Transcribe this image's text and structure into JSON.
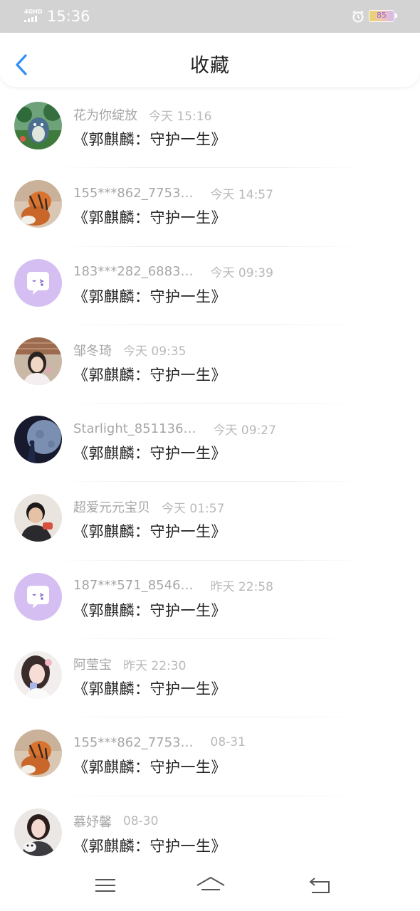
{
  "status_bar": {
    "network": "4GHD",
    "time": "15:36",
    "battery": "85"
  },
  "header": {
    "title": "收藏",
    "back_icon": "chevron-left-icon",
    "accent": "#2f8ff5"
  },
  "favorites": [
    {
      "user": "花为你绽放",
      "time": "今天 15:16",
      "content": "《郭麒麟：守护一生》",
      "avatar": "forest-totoro"
    },
    {
      "user": "155***862_7753…",
      "time": "今天 14:57",
      "content": "《郭麒麟：守护一生》",
      "avatar": "tiger-cat"
    },
    {
      "user": "183***282_6883…",
      "time": "今天 09:39",
      "content": "《郭麒麟：守护一生》",
      "avatar": "default-chat-bubble"
    },
    {
      "user": "邹冬琦",
      "time": "今天 09:35",
      "content": "《郭麒麟：守护一生》",
      "avatar": "girl-portrait"
    },
    {
      "user": "Starlight_851136…",
      "time": "今天 09:27",
      "content": "《郭麒麟：守护一生》",
      "avatar": "moon-night"
    },
    {
      "user": "超爱元元宝贝",
      "time": "今天 01:57",
      "content": "《郭麒麟：守护一生》",
      "avatar": "boy-portrait"
    },
    {
      "user": "187***571_8546…",
      "time": "昨天 22:58",
      "content": "《郭麒麟：守护一生》",
      "avatar": "default-chat-bubble"
    },
    {
      "user": "阿莹宝",
      "time": "昨天 22:30",
      "content": "《郭麒麟：守护一生》",
      "avatar": "anime-girl"
    },
    {
      "user": "155***862_7753…",
      "time": "08-31",
      "content": "《郭麒麟：守护一生》",
      "avatar": "tiger-cat"
    },
    {
      "user": "慕妤馨",
      "time": "08-30",
      "content": "《郭麒麟：守护一生》",
      "avatar": "girl-with-cat"
    }
  ],
  "nav_bar": {
    "menu_icon": "menu-icon",
    "home_icon": "home-icon",
    "back_icon": "back-arrow-icon"
  }
}
